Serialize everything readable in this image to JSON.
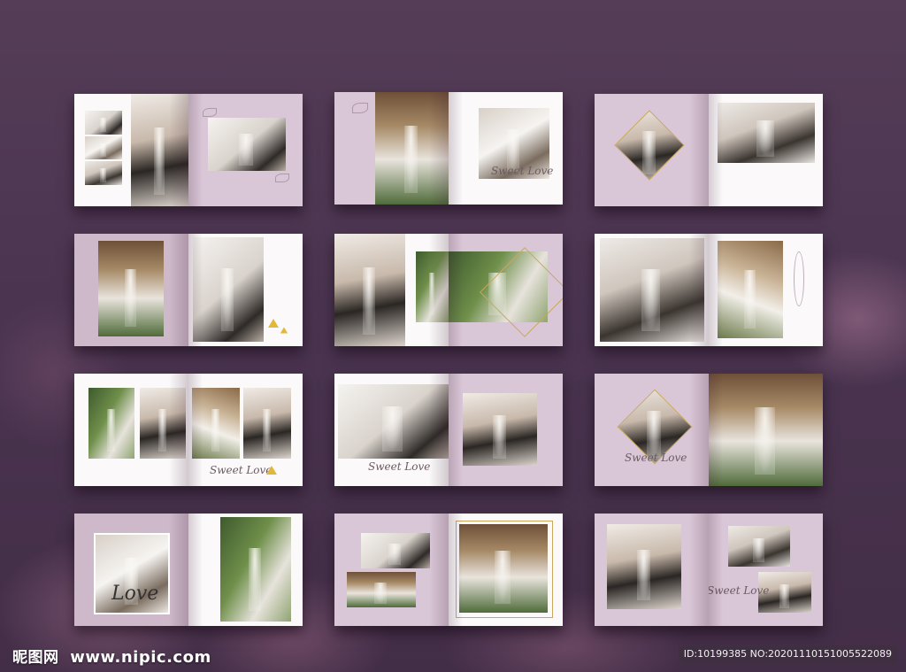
{
  "watermark": {
    "logo": "昵图网",
    "site": "www.nipic.com"
  },
  "image_id": "ID:10199385 NO:20201110151005522089",
  "albums": [
    {
      "script": ""
    },
    {
      "script": "Sweet Love"
    },
    {
      "script": ""
    },
    {
      "script": ""
    },
    {
      "script": ""
    },
    {
      "script": ""
    },
    {
      "script": "Sweet Love"
    },
    {
      "script": "Sweet Love"
    },
    {
      "script": "Sweet Love"
    },
    {
      "script": "Love"
    },
    {
      "script": ""
    },
    {
      "script": "Sweet Love"
    }
  ]
}
